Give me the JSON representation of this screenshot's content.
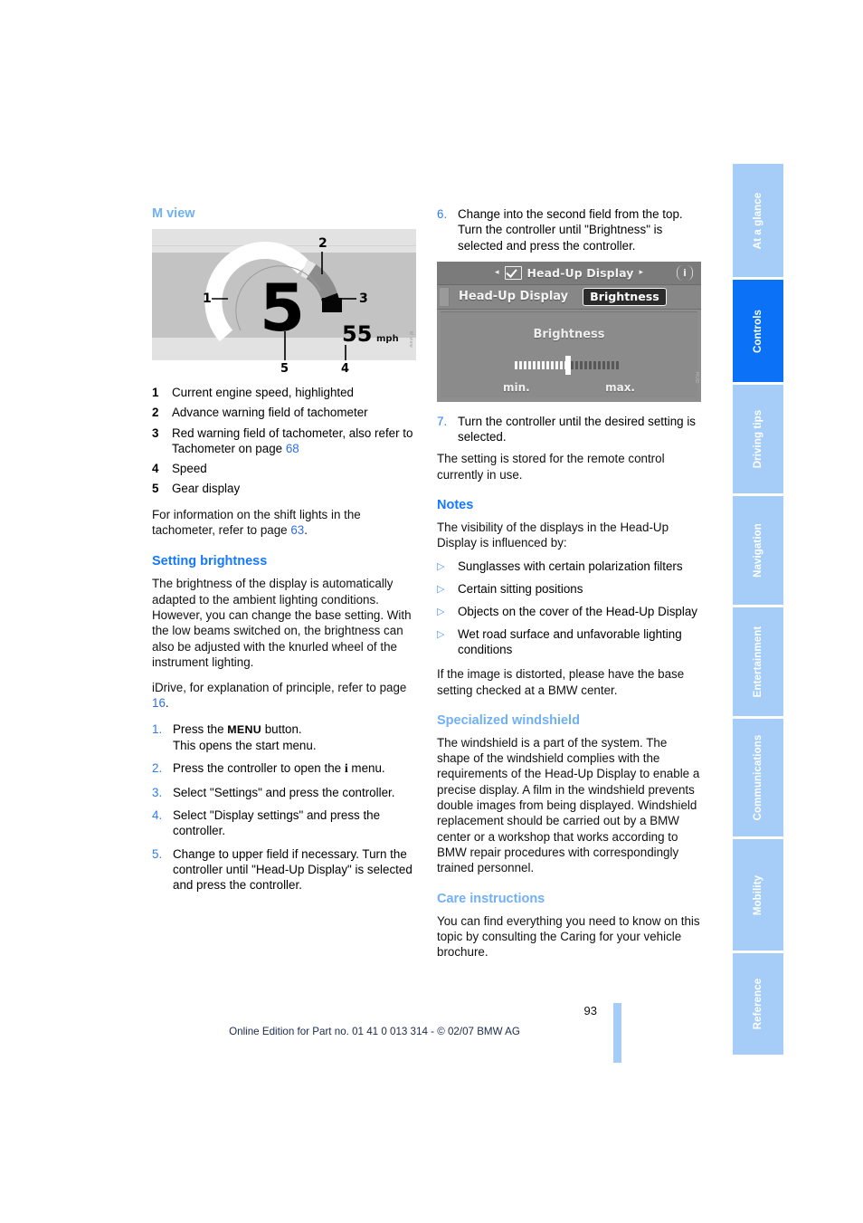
{
  "document": {
    "page_number": "93",
    "footer_note": "Online Edition for Part no. 01 41 0 013 314 - © 02/07 BMW AG"
  },
  "colors": {
    "heading_light": "#6fb0f6",
    "heading_strong": "#1479ff",
    "tab_inactive": "#a6cdf7",
    "tab_active": "#0b72f7",
    "cross_reference": "#2f6fe0"
  },
  "tab_rail": {
    "items": [
      {
        "label": "At a glance",
        "active": false
      },
      {
        "label": "Controls",
        "active": true
      },
      {
        "label": "Driving tips",
        "active": false
      },
      {
        "label": "Navigation",
        "active": false
      },
      {
        "label": "Entertainment",
        "active": false
      },
      {
        "label": "Communications",
        "active": false
      },
      {
        "label": "Mobility",
        "active": false
      },
      {
        "label": "Reference",
        "active": false
      }
    ]
  },
  "left_column": {
    "m_view": {
      "heading": "M view",
      "figure": {
        "name": "m-view-tachometer",
        "callouts": [
          "1",
          "2",
          "3",
          "4",
          "5"
        ],
        "gear_display": "5",
        "speed_value": "55",
        "speed_unit": "mph"
      },
      "legend": [
        {
          "num": "1",
          "text": "Current engine speed, highlighted"
        },
        {
          "num": "2",
          "text": "Advance warning field of tachometer"
        },
        {
          "num": "3",
          "text": "Red warning field of tachometer, also refer to Tachometer on page ",
          "xref": "68",
          "after": ""
        },
        {
          "num": "4",
          "text": "Speed"
        },
        {
          "num": "5",
          "text": "Gear display"
        }
      ],
      "note_before": "For information on the shift lights in the tachometer, refer to page ",
      "note_xref": "63",
      "note_after": "."
    },
    "setting_brightness": {
      "heading": "Setting brightness",
      "paragraph": "The brightness of the display is automatically adapted to the ambient lighting conditions. However, you can change the base setting. With the low beams switched on, the brightness can also be adjusted with the knurled wheel of the instrument lighting.",
      "idrive_before": "iDrive, for explanation of principle, refer to page ",
      "idrive_xref": "16",
      "idrive_after": ".",
      "steps": [
        {
          "num": "1.",
          "before": "Press the ",
          "kbd": "MENU",
          "after": " button.\nThis opens the start menu."
        },
        {
          "num": "2.",
          "before": "Press the controller to open the ",
          "icon": "i",
          "after": " menu."
        },
        {
          "num": "3.",
          "text": "Select \"Settings\" and press the controller."
        },
        {
          "num": "4.",
          "text": "Select \"Display settings\" and press the controller."
        },
        {
          "num": "5.",
          "text": "Change to upper field if necessary. Turn the controller until \"Head-Up Display\" is selected and press the controller."
        }
      ]
    }
  },
  "right_column": {
    "step6": {
      "num": "6.",
      "text": "Change into the second field from the top. Turn the controller until \"Brightness\" is selected and press the controller."
    },
    "idrive_figure": {
      "name": "idrive-head-up-display-brightness",
      "title": "Head-Up Display",
      "left_arrow": "◂",
      "right_arrow": "▸",
      "info_glyph": "i",
      "checkbox_icon": "checkmark-icon",
      "row_label": "Head-Up Display",
      "selected_chip": "Brightness",
      "body_title": "Brightness",
      "slider_min_label": "min.",
      "slider_max_label": "max."
    },
    "step7": {
      "num": "7.",
      "text": "Turn the controller until the desired setting is selected."
    },
    "stored_note": "The setting is stored for the remote control currently in use.",
    "notes": {
      "heading": "Notes",
      "intro": "The visibility of the displays in the Head-Up Display is influenced by:",
      "bullets": [
        "Sunglasses with certain polarization filters",
        "Certain sitting positions",
        "Objects on the cover of the Head-Up Display",
        "Wet road surface and unfavorable lighting conditions"
      ],
      "closing": "If the image is distorted, please have the base setting checked at a BMW center."
    },
    "specialized_windshield": {
      "heading": "Specialized windshield",
      "paragraph": "The windshield is a part of the system. The shape of the windshield complies with the requirements of the Head-Up Display to enable a precise display. A film in the windshield prevents double images from being displayed. Windshield replacement should be carried out by a BMW center or a workshop that works according to BMW repair procedures with correspondingly trained personnel."
    },
    "care_instructions": {
      "heading": "Care instructions",
      "paragraph": "You can find everything you need to know on this topic by consulting the Caring for your vehicle brochure."
    }
  }
}
